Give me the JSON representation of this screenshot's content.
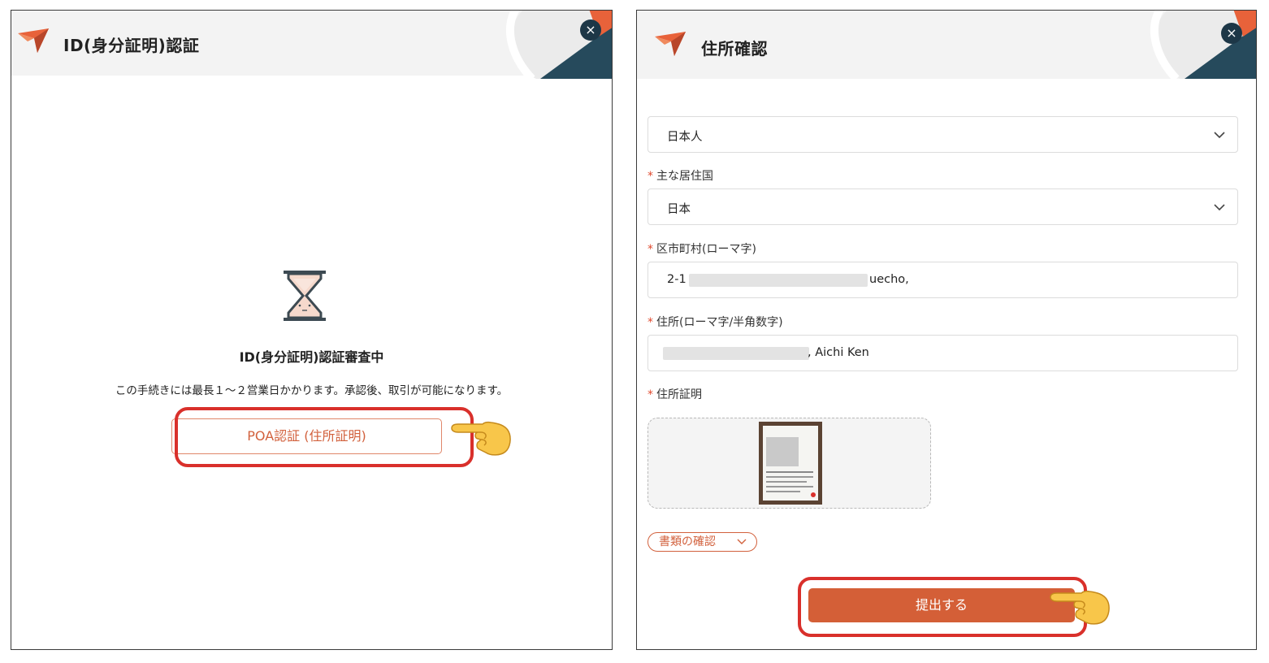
{
  "left_panel": {
    "title": "ID(身分証明)認証",
    "close_label": "×",
    "status_title": "ID(身分証明)認証審査中",
    "status_description": "この手続きには最長１〜２営業日かかります。承認後、取引が可能になります。",
    "poa_button_label": "POA認証 (住所証明)"
  },
  "right_panel": {
    "title": "住所確認",
    "close_label": "×",
    "nationality_select": {
      "value": "日本人"
    },
    "country_label": "主な居住国",
    "country_select": {
      "value": "日本"
    },
    "city_label": "区市町村(ローマ字)",
    "city_value_prefix": "2-1",
    "city_value_suffix": "uecho,",
    "address_label": "住所(ローマ字/半角数字)",
    "address_value_suffix": ", Aichi Ken",
    "proof_label": "住所証明",
    "doc_check_label": "書類の確認",
    "submit_label": "提出する"
  },
  "colors": {
    "brand_orange": "#d45f37",
    "highlight_red": "#d9302b",
    "dark_teal": "#1d3747"
  },
  "icons": {
    "logo": "brand-arrow-logo",
    "hourglass": "hourglass-icon",
    "pointer": "pointing-hand-emoji",
    "chevron": "chevron-down-icon"
  }
}
